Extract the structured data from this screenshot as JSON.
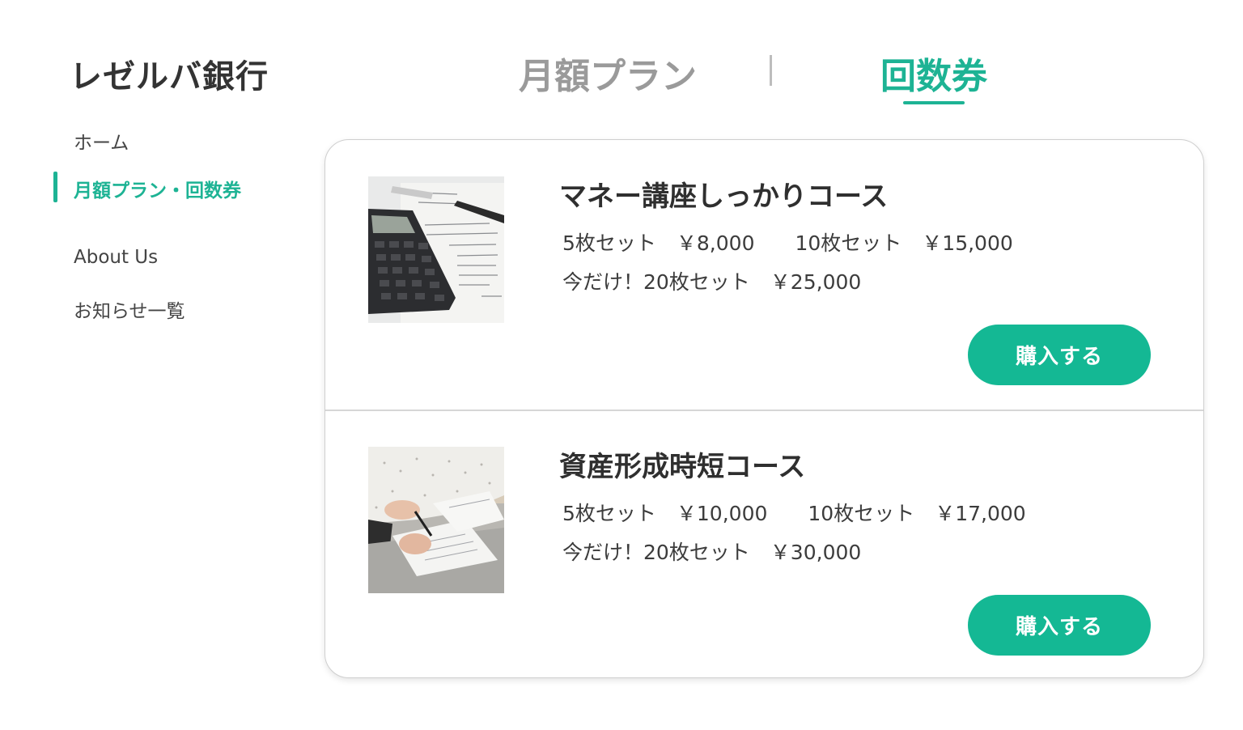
{
  "brand": {
    "name": "レゼルバ銀行"
  },
  "sidebar": {
    "items": [
      {
        "label": "ホーム"
      },
      {
        "label": "月額プラン・回数券",
        "active": true
      },
      {
        "label": "About Us"
      },
      {
        "label": "お知らせ一覧"
      }
    ]
  },
  "tabs": [
    {
      "label": "月額プラン"
    },
    {
      "label": "回数券",
      "active": true
    }
  ],
  "courses": [
    {
      "title": "マネー講座しっかりコース",
      "prices_line1": "5枚セット　￥8,000　　10枚セット　￥15,000",
      "prices_line2": "今だけ！20枚セット　￥25,000",
      "button": "購入する",
      "image": "calculator-and-documents-photo"
    },
    {
      "title": "資産形成時短コース",
      "prices_line1": "5枚セット　￥10,000　　10枚セット　￥17,000",
      "prices_line2": "今だけ！20枚セット　￥30,000",
      "button": "購入する",
      "image": "person-writing-on-paper-photo"
    }
  ],
  "colors": {
    "accent": "#1db394",
    "button": "#14b894",
    "inactive_tab": "#9a9a9a"
  }
}
